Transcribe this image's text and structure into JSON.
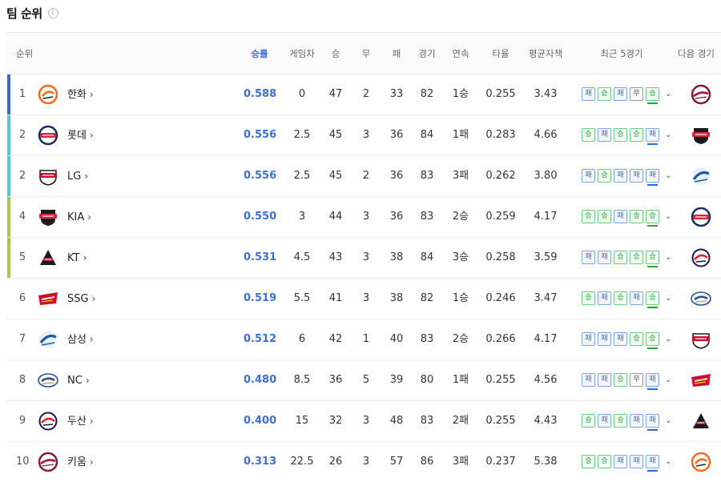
{
  "page": {
    "title": "팀 순위",
    "info_icon": "info-icon"
  },
  "columns": {
    "rank": "순위",
    "win_pct": "승률",
    "games_behind": "게임차",
    "wins": "승",
    "draws": "무",
    "losses": "패",
    "games": "경기",
    "streak": "연속",
    "batting_avg": "타율",
    "era": "평균자책",
    "recent": "최근 5경기",
    "next_game": "다음 경기"
  },
  "result_labels": {
    "w": "승",
    "l": "패",
    "d": "무"
  },
  "rows": [
    {
      "rank": "1",
      "team": "한화",
      "pct": "0.588",
      "gb": "0",
      "w": "47",
      "d": "2",
      "l": "33",
      "g": "82",
      "streak": "1승",
      "avg": "0.255",
      "era": "3.43",
      "recent": [
        "l",
        "w",
        "l",
        "d",
        "w"
      ],
      "bar": "#3a6ad4",
      "logo": "eagles",
      "next": "heroes"
    },
    {
      "rank": "2",
      "team": "롯데",
      "pct": "0.556",
      "gb": "2.5",
      "w": "45",
      "d": "3",
      "l": "36",
      "g": "84",
      "streak": "1패",
      "avg": "0.283",
      "era": "4.66",
      "recent": [
        "w",
        "l",
        "w",
        "w",
        "l"
      ],
      "bar": "#4fc6e0",
      "logo": "giants",
      "next": "tigers"
    },
    {
      "rank": "2",
      "team": "LG",
      "pct": "0.556",
      "gb": "2.5",
      "w": "45",
      "d": "2",
      "l": "36",
      "g": "83",
      "streak": "3패",
      "avg": "0.262",
      "era": "3.80",
      "recent": [
        "l",
        "w",
        "l",
        "l",
        "l"
      ],
      "bar": "#4fc6e0",
      "logo": "twins",
      "next": "lions"
    },
    {
      "rank": "4",
      "team": "KIA",
      "pct": "0.550",
      "gb": "3",
      "w": "44",
      "d": "3",
      "l": "36",
      "g": "83",
      "streak": "2승",
      "avg": "0.259",
      "era": "4.17",
      "recent": [
        "w",
        "w",
        "l",
        "w",
        "w"
      ],
      "bar": "#9ccc4a",
      "logo": "tigers",
      "next": "giants"
    },
    {
      "rank": "5",
      "team": "KT",
      "pct": "0.531",
      "gb": "4.5",
      "w": "43",
      "d": "3",
      "l": "38",
      "g": "84",
      "streak": "3승",
      "avg": "0.258",
      "era": "3.59",
      "recent": [
        "l",
        "l",
        "w",
        "w",
        "w"
      ],
      "bar": "#9ccc4a",
      "logo": "wiz",
      "next": "bears"
    },
    {
      "rank": "6",
      "team": "SSG",
      "pct": "0.519",
      "gb": "5.5",
      "w": "41",
      "d": "3",
      "l": "38",
      "g": "82",
      "streak": "1승",
      "avg": "0.246",
      "era": "3.47",
      "recent": [
        "w",
        "l",
        "w",
        "l",
        "w"
      ],
      "bar": "",
      "logo": "landers",
      "next": "dinos"
    },
    {
      "rank": "7",
      "team": "삼성",
      "pct": "0.512",
      "gb": "6",
      "w": "42",
      "d": "1",
      "l": "40",
      "g": "83",
      "streak": "2승",
      "avg": "0.266",
      "era": "4.17",
      "recent": [
        "l",
        "l",
        "l",
        "w",
        "w"
      ],
      "bar": "",
      "logo": "lions",
      "next": "twins"
    },
    {
      "rank": "8",
      "team": "NC",
      "pct": "0.480",
      "gb": "8.5",
      "w": "36",
      "d": "5",
      "l": "39",
      "g": "80",
      "streak": "1패",
      "avg": "0.255",
      "era": "4.56",
      "recent": [
        "l",
        "l",
        "w",
        "d",
        "l"
      ],
      "bar": "",
      "logo": "dinos",
      "next": "landers"
    },
    {
      "rank": "9",
      "team": "두산",
      "pct": "0.400",
      "gb": "15",
      "w": "32",
      "d": "3",
      "l": "48",
      "g": "83",
      "streak": "2패",
      "avg": "0.255",
      "era": "4.43",
      "recent": [
        "w",
        "l",
        "w",
        "l",
        "l"
      ],
      "bar": "",
      "logo": "bears",
      "next": "wiz"
    },
    {
      "rank": "10",
      "team": "키움",
      "pct": "0.313",
      "gb": "22.5",
      "w": "26",
      "d": "3",
      "l": "57",
      "g": "86",
      "streak": "3패",
      "avg": "0.237",
      "era": "5.38",
      "recent": [
        "w",
        "w",
        "l",
        "l",
        "l"
      ],
      "bar": "",
      "logo": "heroes",
      "next": "eagles"
    }
  ]
}
